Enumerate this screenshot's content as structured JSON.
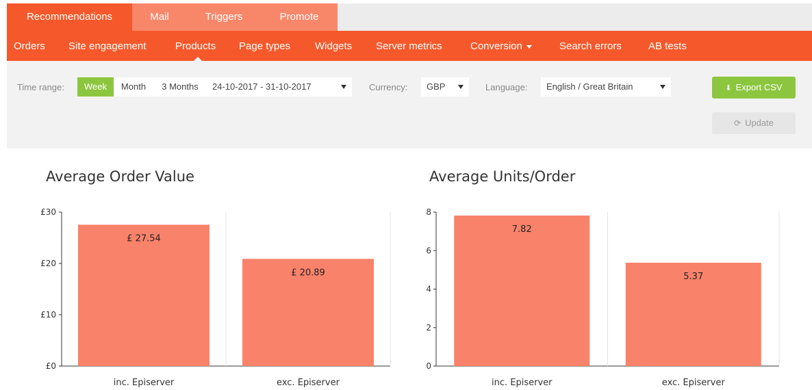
{
  "top_tabs": [
    {
      "label": "Recommendations",
      "active": true
    },
    {
      "label": "Mail",
      "active": false
    },
    {
      "label": "Triggers",
      "active": false
    },
    {
      "label": "Promote",
      "active": false
    }
  ],
  "sub_nav": [
    {
      "label": "Orders"
    },
    {
      "label": "Site engagement"
    },
    {
      "label": "Products",
      "active": true
    },
    {
      "label": "Page types"
    },
    {
      "label": "Widgets"
    },
    {
      "label": "Server metrics"
    },
    {
      "label": "Conversion",
      "dropdown": true
    },
    {
      "label": "Search errors"
    },
    {
      "label": "AB tests"
    }
  ],
  "filters": {
    "time_range_label": "Time range:",
    "ranges": [
      {
        "label": "Week",
        "active": true
      },
      {
        "label": "Month",
        "active": false
      },
      {
        "label": "3 Months",
        "active": false
      }
    ],
    "date_range": "24-10-2017 - 31-10-2017",
    "currency_label": "Currency:",
    "currency": "GBP",
    "language_label": "Language:",
    "language": "English / Great Britain"
  },
  "buttons": {
    "export": "Export CSV",
    "update": "Update"
  },
  "icons": {
    "export": "download-icon",
    "update": "refresh-icon"
  },
  "colors": {
    "brand": "#f5592b",
    "tab_inactive": "#f8876a",
    "accent_green": "#8cc63f",
    "bar": "#f9826a"
  },
  "chart_data": [
    {
      "type": "bar",
      "title": "Average Order Value",
      "categories": [
        "inc. Episerver",
        "exc. Episerver"
      ],
      "values": [
        27.54,
        20.89
      ],
      "data_labels": [
        "£ 27.54",
        "£ 20.89"
      ],
      "yticks": [
        "£0",
        "£10",
        "£20",
        "£30"
      ],
      "ylim": [
        0,
        30
      ],
      "xlabel": "",
      "ylabel": ""
    },
    {
      "type": "bar",
      "title": "Average Units/Order",
      "categories": [
        "inc. Episerver",
        "exc. Episerver"
      ],
      "values": [
        7.82,
        5.37
      ],
      "data_labels": [
        "7.82",
        "5.37"
      ],
      "yticks": [
        "0",
        "2",
        "4",
        "6",
        "8"
      ],
      "ylim": [
        0,
        8
      ],
      "xlabel": "",
      "ylabel": ""
    }
  ]
}
